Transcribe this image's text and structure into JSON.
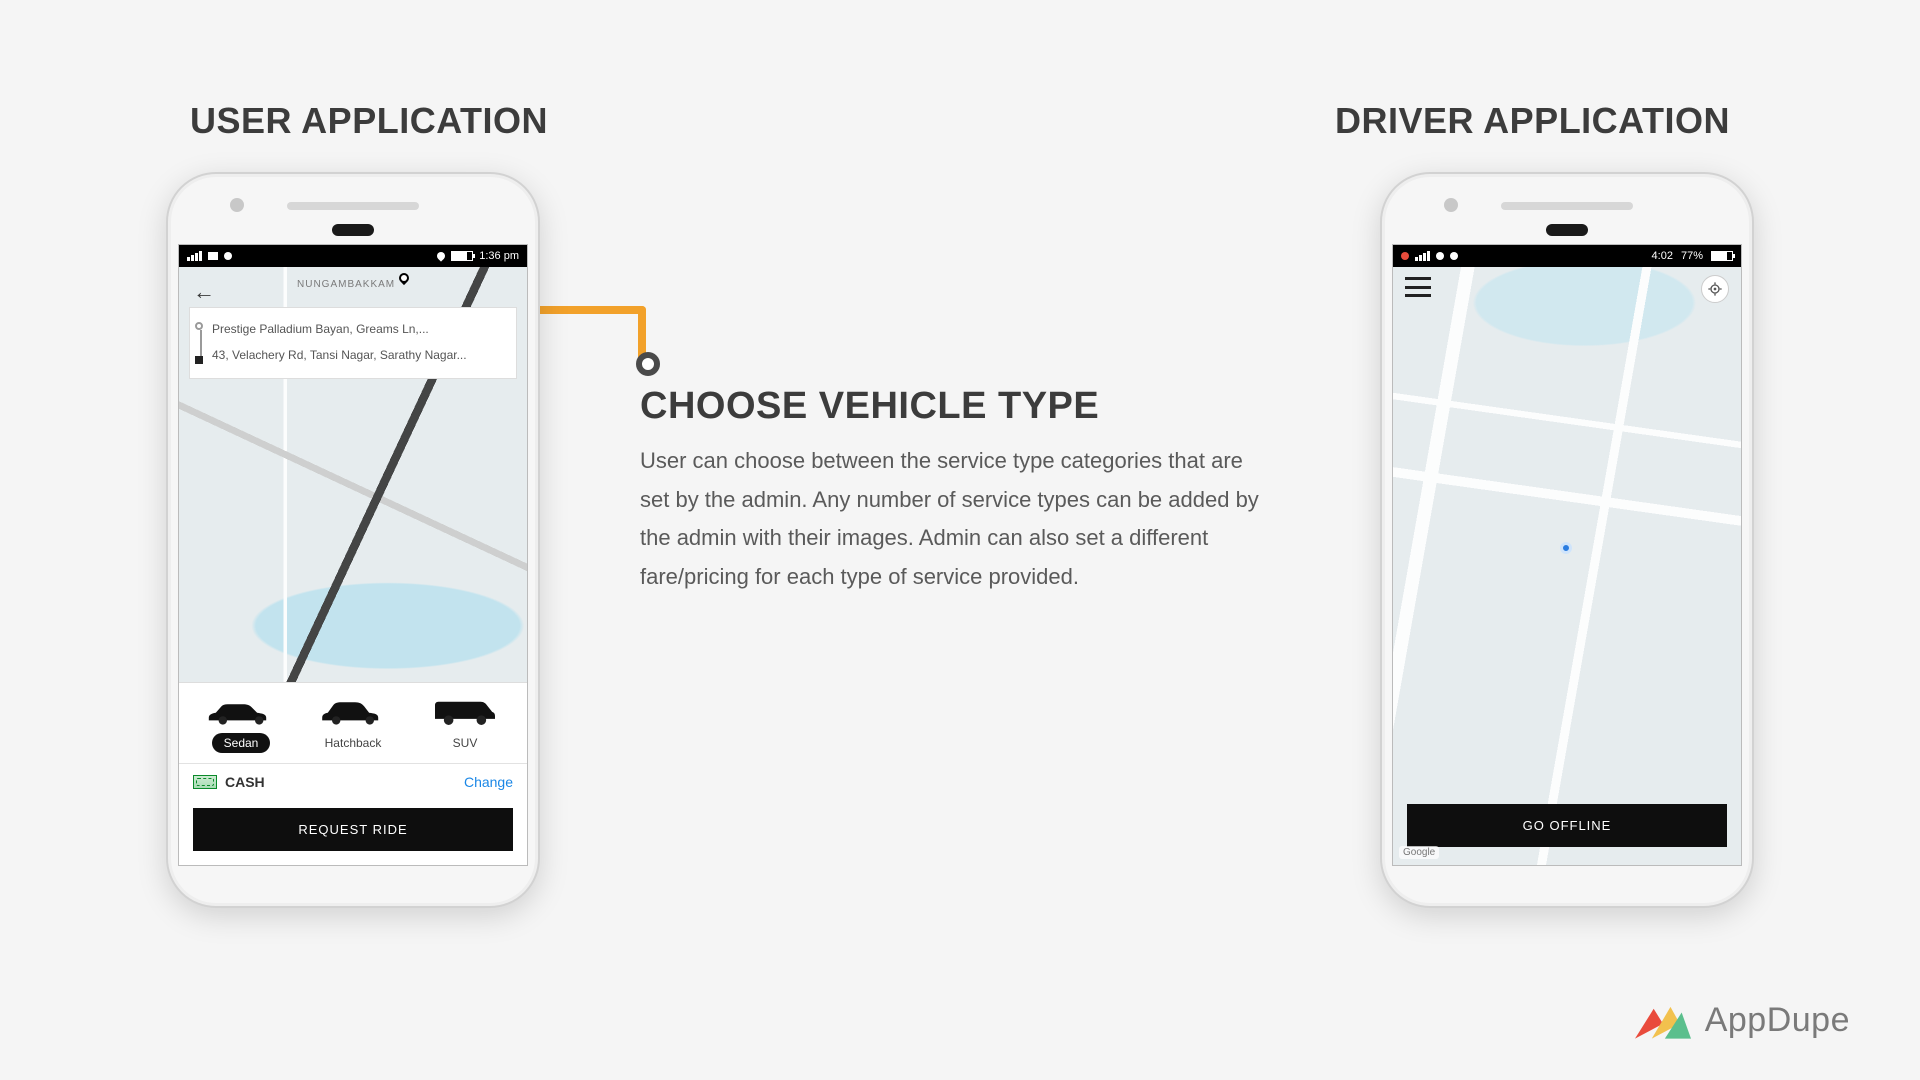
{
  "headings": {
    "user": "USER APPLICATION",
    "driver": "DRIVER APPLICATION"
  },
  "callout": {
    "title": "CHOOSE VEHICLE TYPE",
    "body": "User can choose between the service type categories that are set by the admin. Any number of service types can be added by the admin with their images. Admin can also set a different fare/pricing for each type of service provided."
  },
  "user_app": {
    "status_time": "1:36 pm",
    "map_area_label": "NUNGAMBAKKAM",
    "pickup": "Prestige Palladium Bayan, Greams Ln,...",
    "dropoff": "43, Velachery Rd, Tansi Nagar, Sarathy Nagar...",
    "vehicles": {
      "sedan": "Sedan",
      "hatchback": "Hatchback",
      "suv": "SUV"
    },
    "payment_label": "CASH",
    "change_label": "Change",
    "request_label": "REQUEST RIDE"
  },
  "driver_app": {
    "status_time": "4:02",
    "status_batt": "77%",
    "go_offline": "GO OFFLINE",
    "map_attrib": "Google"
  },
  "brand": "AppDupe"
}
